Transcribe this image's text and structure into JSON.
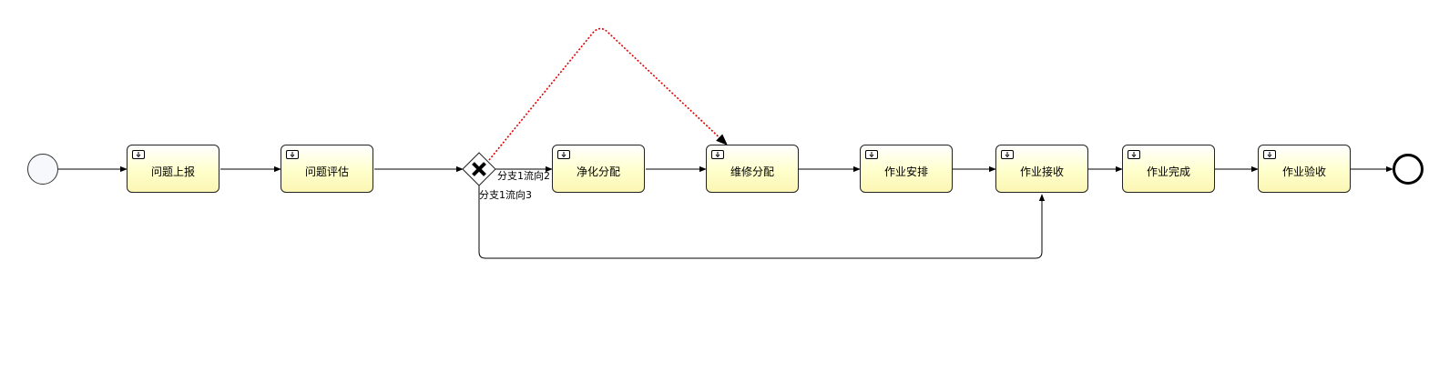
{
  "tasks": [
    {
      "id": "t1",
      "label": "问题上报"
    },
    {
      "id": "t2",
      "label": "问题评估"
    },
    {
      "id": "t3",
      "label": "净化分配"
    },
    {
      "id": "t4",
      "label": "维修分配"
    },
    {
      "id": "t5",
      "label": "作业安排"
    },
    {
      "id": "t6",
      "label": "作业接收"
    },
    {
      "id": "t7",
      "label": "作业完成"
    },
    {
      "id": "t8",
      "label": "作业验收"
    }
  ],
  "gateway": {
    "type": "exclusive"
  },
  "flow_labels": {
    "branch_flow_2": "分支1流向2",
    "branch_flow_3": "分支1流向3"
  },
  "colors": {
    "sequence_flow": "#000000",
    "highlight_flow": "#e00000",
    "task_fill": "#ffffcc",
    "start_event_fill": "#f7f8fb"
  },
  "icons": {
    "task": "user-task-icon",
    "gateway": "exclusive-gateway-icon"
  }
}
